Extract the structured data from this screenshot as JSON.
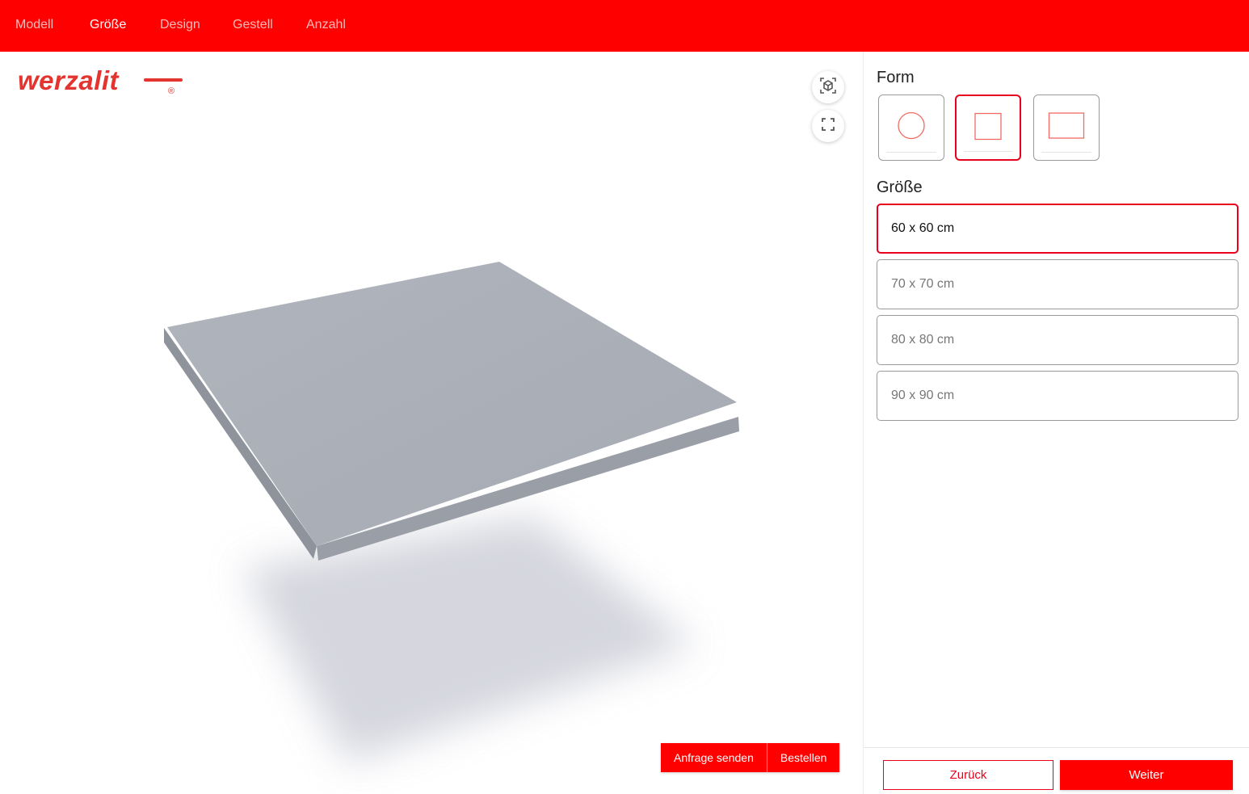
{
  "nav": {
    "items": [
      {
        "label": "Modell",
        "active": false
      },
      {
        "label": "Größe",
        "active": true
      },
      {
        "label": "Design",
        "active": false
      },
      {
        "label": "Gestell",
        "active": false
      },
      {
        "label": "Anzahl",
        "active": false
      }
    ]
  },
  "brand": {
    "logo_text": "werzalit",
    "registered_mark": "®",
    "color": "#e3342f"
  },
  "viewer": {
    "controls": [
      {
        "icon": "ar-cube-icon"
      },
      {
        "icon": "fullscreen-icon"
      }
    ],
    "actions": {
      "inquiry_label": "Anfrage senden",
      "order_label": "Bestellen"
    }
  },
  "sidebar": {
    "form_title": "Form",
    "form_options": [
      {
        "icon": "circle-shape-icon",
        "selected": false
      },
      {
        "icon": "square-shape-icon",
        "selected": true
      },
      {
        "icon": "rectangle-shape-icon",
        "selected": false
      }
    ],
    "size_title": "Größe",
    "size_options": [
      {
        "label": "60 x 60 cm",
        "selected": true
      },
      {
        "label": "70 x 70 cm",
        "selected": false
      },
      {
        "label": "80 x 80 cm",
        "selected": false
      },
      {
        "label": "90 x 90 cm",
        "selected": false
      }
    ],
    "back_label": "Zurück",
    "next_label": "Weiter"
  },
  "colors": {
    "accent": "#ff0000",
    "selected_border": "#e8001c",
    "tabletop": "#a9adb6"
  }
}
